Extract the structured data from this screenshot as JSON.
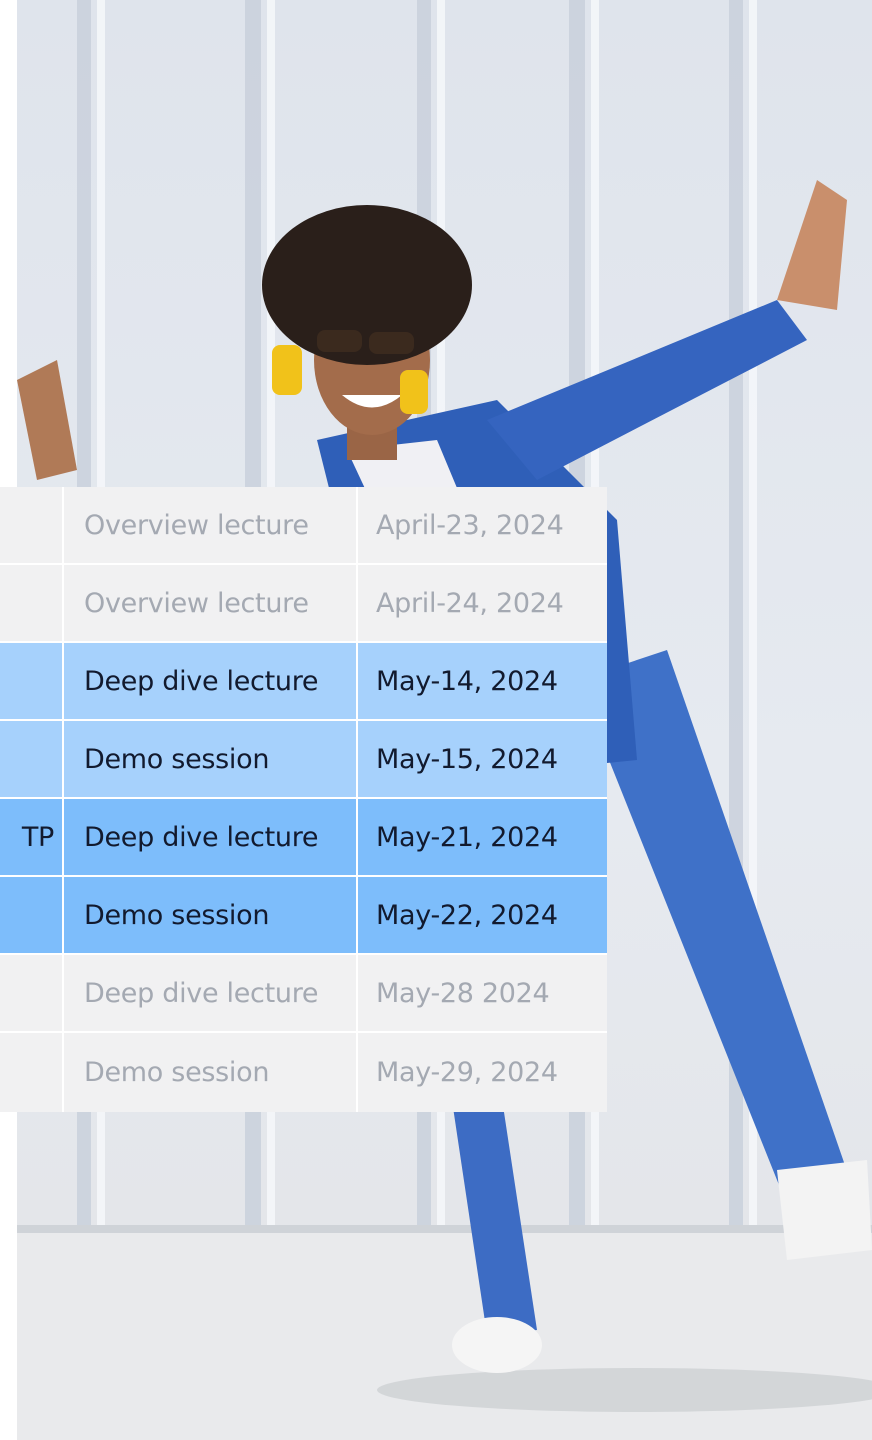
{
  "image": {
    "description_icon": "person-dancing-photo"
  },
  "schedule": {
    "rows": [
      {
        "state": "past",
        "topic_fragment": "",
        "session": "Overview lecture",
        "date": "April-23, 2024"
      },
      {
        "state": "past",
        "topic_fragment": "",
        "session": "Overview lecture",
        "date": "April-24, 2024"
      },
      {
        "state": "current-a",
        "topic_fragment": "",
        "session": "Deep dive lecture",
        "date": "May-14, 2024"
      },
      {
        "state": "current-a",
        "topic_fragment": "",
        "session": "Demo session",
        "date": "May-15, 2024"
      },
      {
        "state": "current-b",
        "topic_fragment": "TP",
        "session": "Deep dive lecture",
        "date": "May-21, 2024"
      },
      {
        "state": "current-b",
        "topic_fragment": "",
        "session": "Demo session",
        "date": "May-22, 2024"
      },
      {
        "state": "past",
        "topic_fragment": "",
        "session": "Deep dive lecture",
        "date": "May-28 2024"
      },
      {
        "state": "past",
        "topic_fragment": "",
        "session": "Demo session",
        "date": "May-29, 2024"
      }
    ]
  },
  "colors": {
    "past_row_bg": "#f1f1f2",
    "past_row_text": "#a4a9b2",
    "highlight_light": "#a6d1fc",
    "highlight_strong": "#7dbdfb",
    "highlight_text": "#121a2e"
  }
}
